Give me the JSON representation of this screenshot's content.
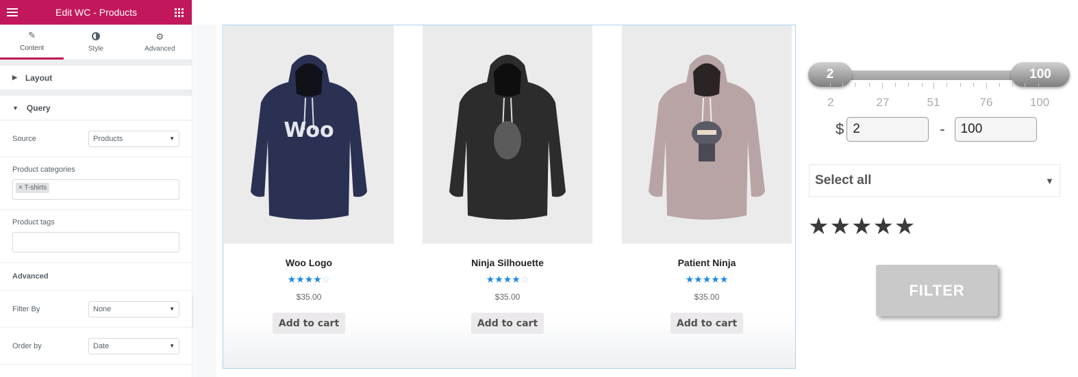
{
  "panel": {
    "title": "Edit WC - Products",
    "tabs": [
      {
        "label": "Content",
        "icon": "pencil-icon"
      },
      {
        "label": "Style",
        "icon": "half-circle-icon"
      },
      {
        "label": "Advanced",
        "icon": "gear-icon"
      }
    ],
    "sections": {
      "layout": "Layout",
      "query": "Query"
    },
    "source": {
      "label": "Source",
      "value": "Products"
    },
    "product_categories": {
      "label": "Product categories",
      "chip": "× T-shirts"
    },
    "product_tags": {
      "label": "Product tags",
      "value": ""
    },
    "advanced": "Advanced",
    "filter_by": {
      "label": "Filter By",
      "value": "None"
    },
    "order_by": {
      "label": "Order by",
      "value": "Date"
    }
  },
  "products": [
    {
      "name": "Woo Logo",
      "rating": 4,
      "price": "$35.00",
      "button": "Add to cart",
      "color": "#2b3152",
      "print": "Woo"
    },
    {
      "name": "Ninja Silhouette",
      "rating": 4,
      "price": "$35.00",
      "button": "Add to cart",
      "color": "#2c2c2c",
      "print": ""
    },
    {
      "name": "Patient Ninja",
      "rating": 5,
      "price": "$35.00",
      "button": "Add to cart",
      "color": "#b8a4a4",
      "print": ""
    }
  ],
  "filter": {
    "slider": {
      "min": 2,
      "max": 100,
      "low": 2,
      "high": 100
    },
    "tick_labels": [
      "2",
      "27",
      "51",
      "76",
      "100"
    ],
    "currency": "$",
    "min_value": "2",
    "max_value": "100",
    "separator": "-",
    "category_select": "Select all",
    "rating_stars": 5,
    "button": "FILTER"
  },
  "colors": {
    "brand": "#c2185b",
    "star_blue": "#1e88e5",
    "frame": "#a8d4ec"
  }
}
